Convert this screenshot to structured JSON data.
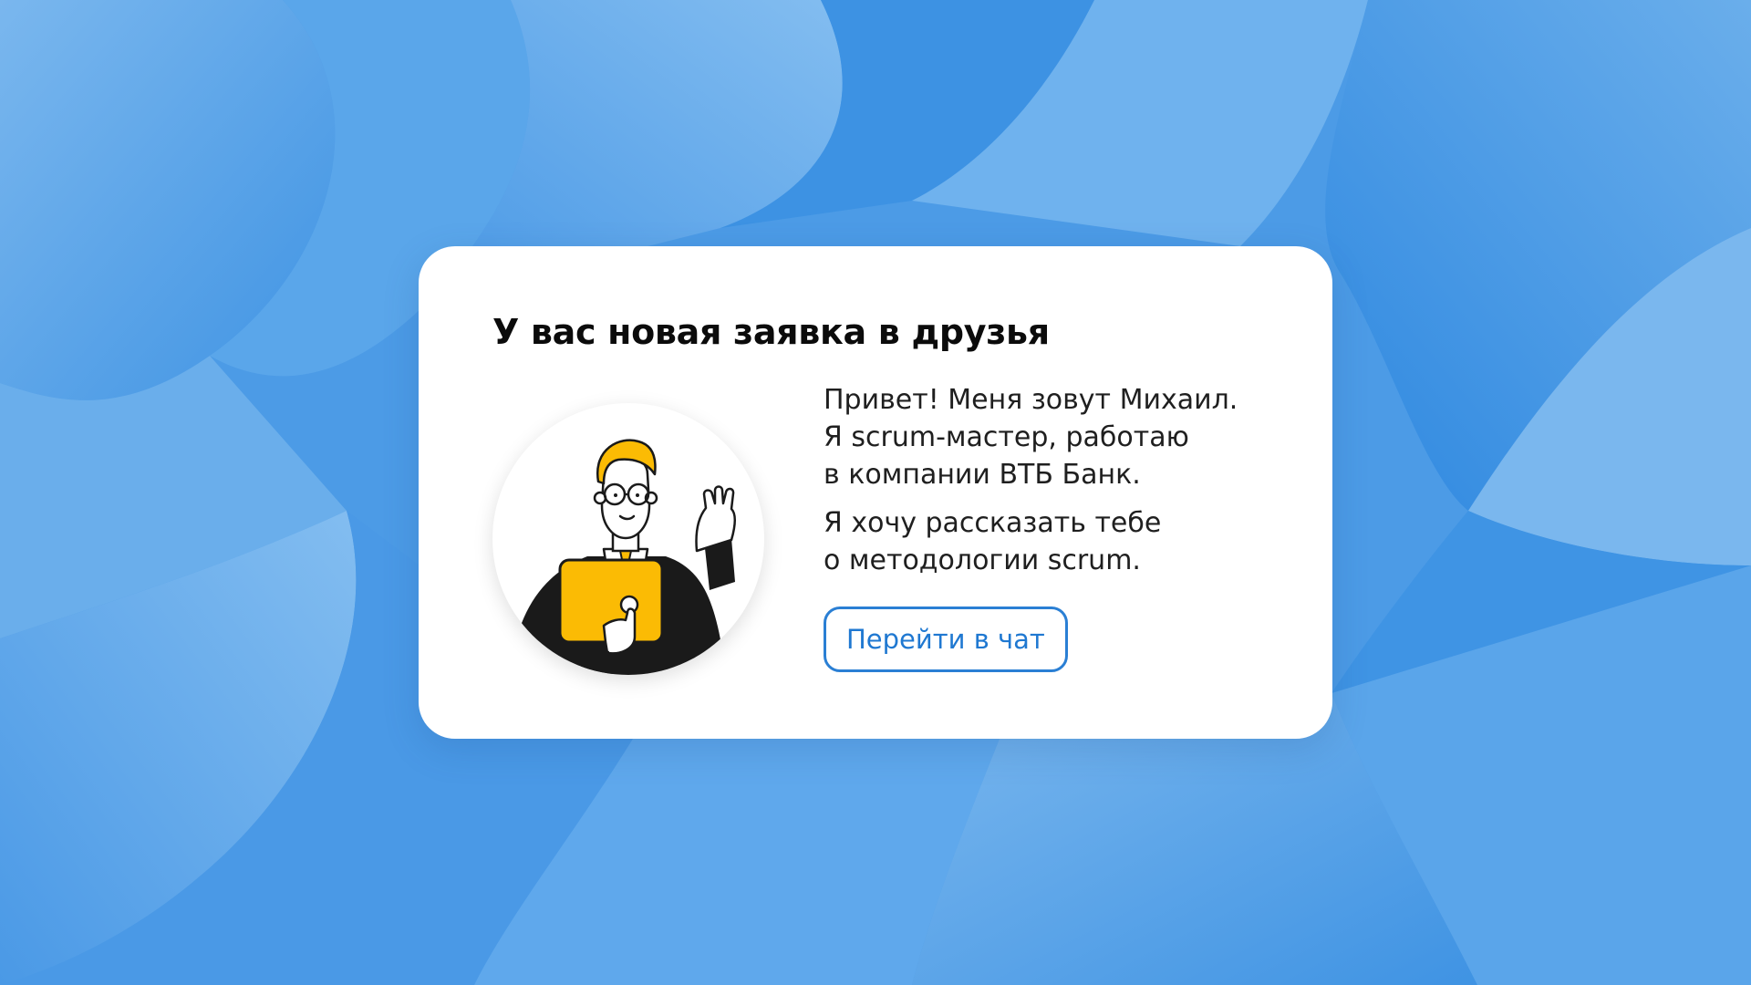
{
  "background": {
    "base_color": "#4c9be6",
    "light_color": "#7ab7ee",
    "dark_color": "#2e88e0"
  },
  "notification": {
    "title": "У вас новая заявка в друзья",
    "avatar_icon": "scrum-master-avatar-icon",
    "message": {
      "paragraph1": {
        "line1": "Привет! Меня зовут Михаил.",
        "line2": "Я scrum-мастер, работаю",
        "line3": "в компании ВТБ Банк."
      },
      "paragraph2": {
        "line1": "Я хочу рассказать тебе",
        "line2": "о методологии scrum."
      }
    },
    "button_label": "Перейти в чат",
    "colors": {
      "accent": "#2a7fd4",
      "character_yellow": "#fbbb04",
      "character_suit": "#1a1a1a"
    }
  }
}
